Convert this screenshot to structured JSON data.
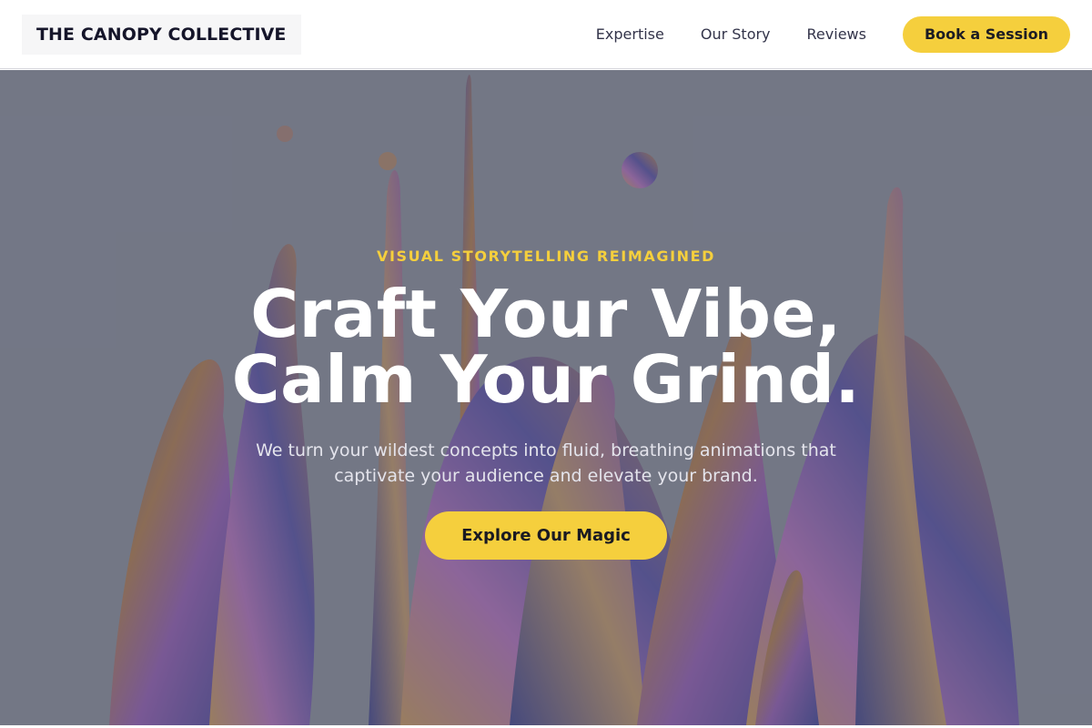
{
  "brand": {
    "name": "THE CANOPY COLLECTIVE"
  },
  "nav": {
    "links": [
      "Expertise",
      "Our Story",
      "Reviews"
    ],
    "cta_label": "Book a Session"
  },
  "hero": {
    "eyebrow": "VISUAL STORYTELLING REIMAGINED",
    "headline_line1": "Craft Your Vibe,",
    "headline_line2": "Calm Your Grind.",
    "subtext": "We turn your wildest concepts into fluid, breathing animations that captivate your audience and elevate your brand.",
    "cta_label": "Explore Our Magic",
    "background_icon": "liquid-splash-image"
  },
  "colors": {
    "accent": "#f5cf3d",
    "brand_text": "#15152a",
    "overlay": "#5c606e"
  }
}
